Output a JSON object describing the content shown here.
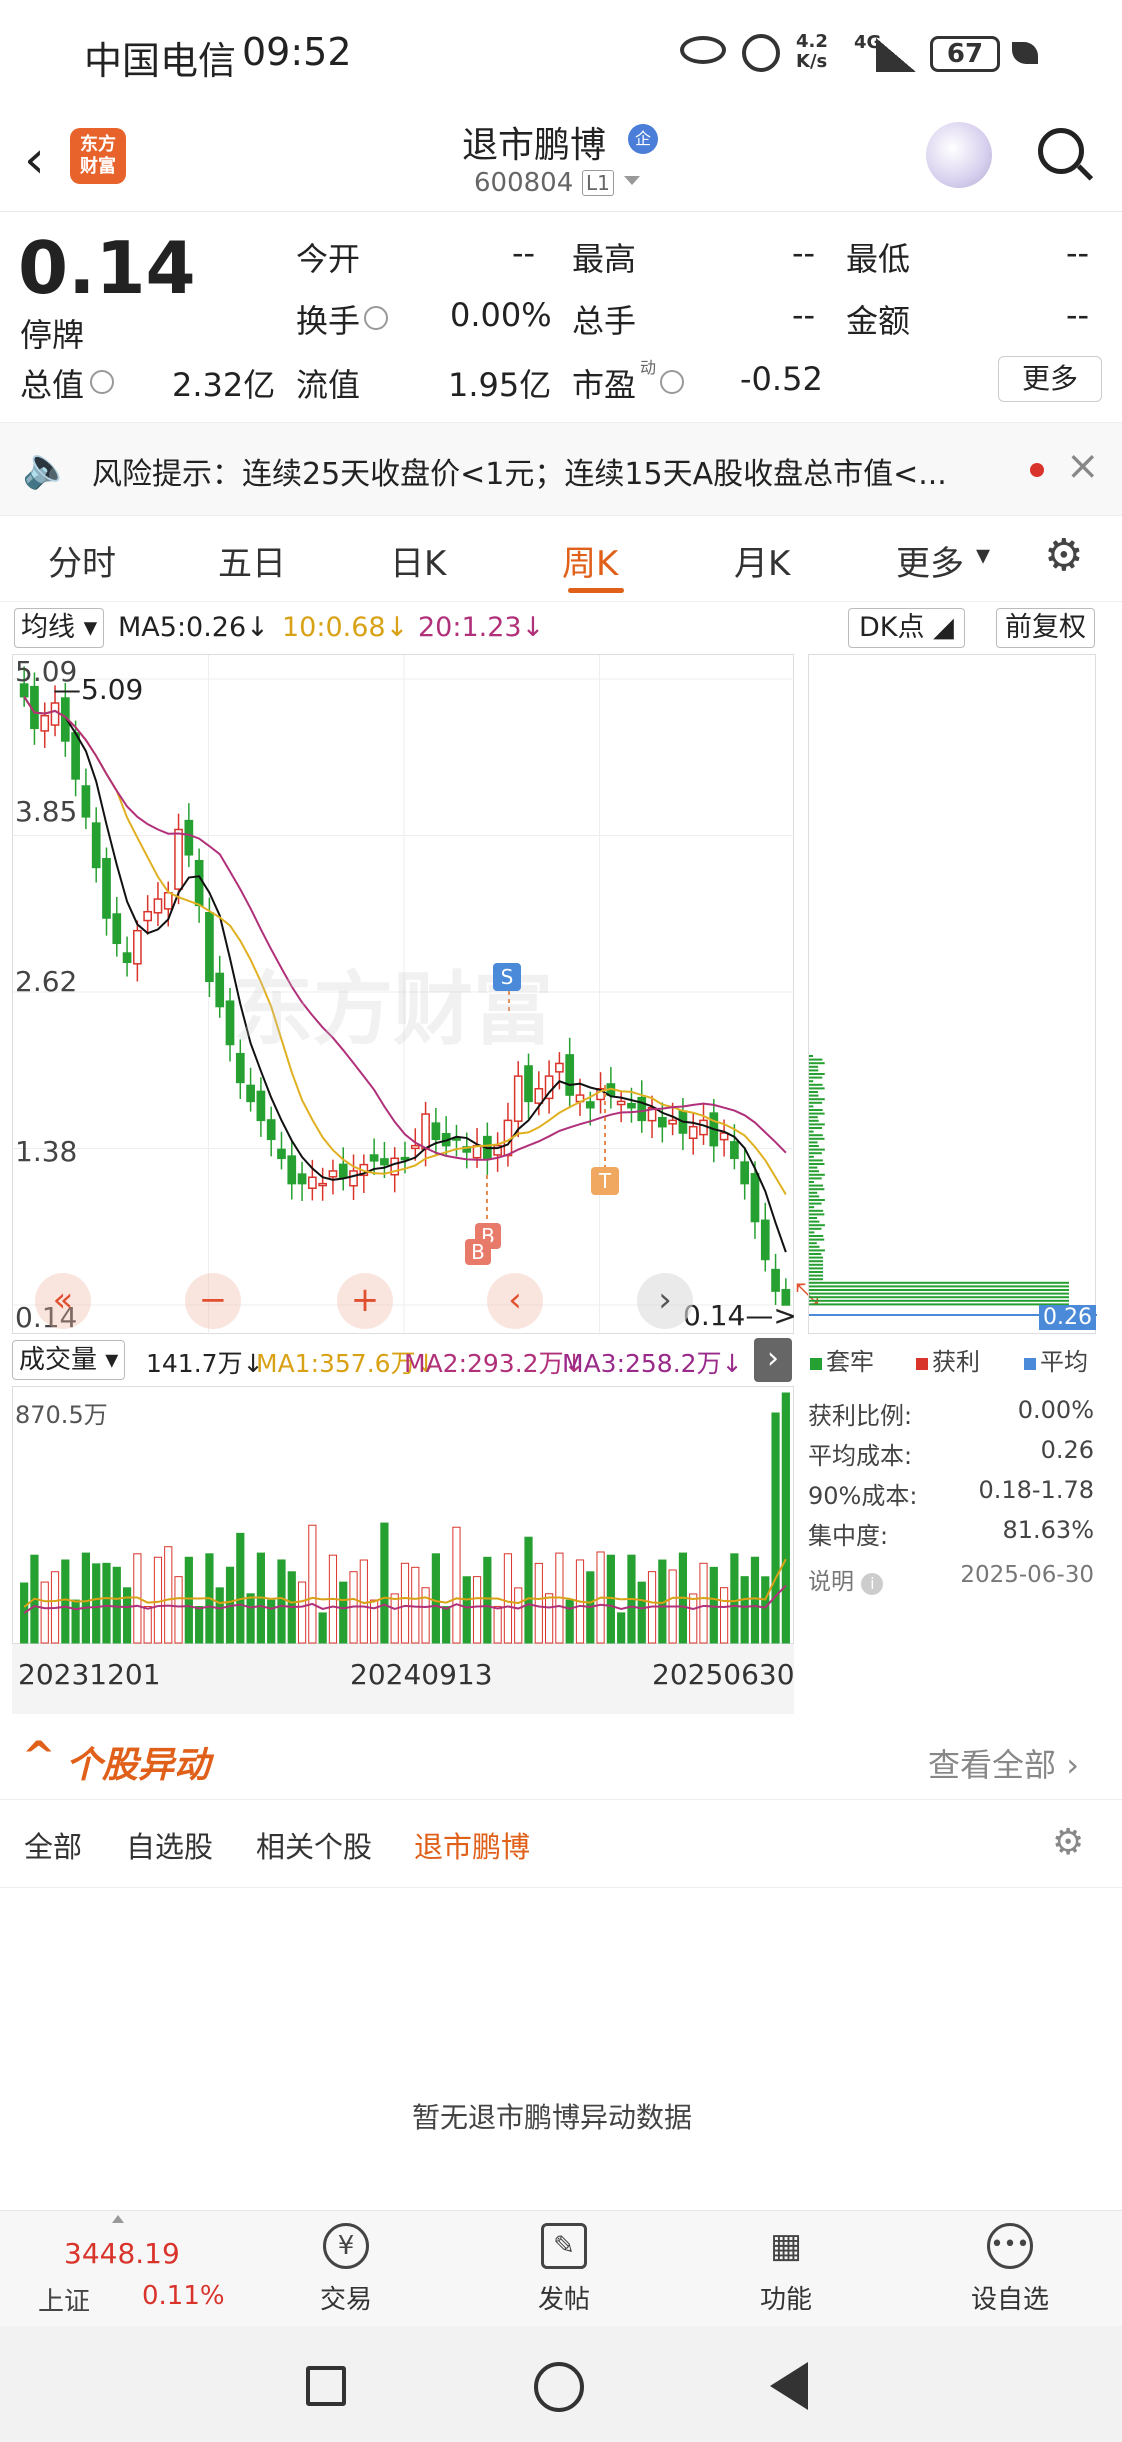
{
  "status_bar": {
    "carrier": "中国电信",
    "time": "09:52",
    "speed_top": "4.2",
    "speed_unit": "K/s",
    "signal": "4G",
    "battery": "67"
  },
  "header": {
    "logo_line1": "东方",
    "logo_line2": "财富",
    "title": "退市鹏博",
    "title_badge": "企",
    "code": "600804",
    "level": "L1"
  },
  "quote": {
    "price": "0.14",
    "status": "停牌",
    "open_label": "今开",
    "open": "--",
    "high_label": "最高",
    "high": "--",
    "low_label": "最低",
    "low": "--",
    "turnover_label": "换手",
    "turnover": "0.00%",
    "volume_label": "总手",
    "volume": "--",
    "amount_label": "金额",
    "amount": "--",
    "mktcap_label": "总值",
    "mktcap": "2.32亿",
    "float_label": "流值",
    "float": "1.95亿",
    "pe_label": "市盈",
    "pe_sup": "动",
    "pe": "-0.52",
    "more_button": "更多"
  },
  "risk": {
    "text": "风险提示：连续25天收盘价<1元；连续15天A股收盘总市值<..."
  },
  "tabs": {
    "items": [
      "分时",
      "五日",
      "日K",
      "周K",
      "月K",
      "更多"
    ],
    "active": "周K"
  },
  "chart_toolbar": {
    "mode": "均线",
    "ma5": "MA5:0.26",
    "ma10": "10:0.68",
    "ma20": "20:1.23",
    "dk_button": "DK点",
    "adjust_button": "前复权"
  },
  "chart_labels": {
    "max_label": "5.09",
    "min_label": "0.14",
    "marker_s": "S",
    "marker_b": "B",
    "marker_t": "T",
    "y_ticks": [
      "5.09",
      "3.85",
      "2.62",
      "1.38",
      "0.14"
    ],
    "watermark": "东方财富"
  },
  "chip_panel": {
    "avg_label": "0.26",
    "legend": [
      "套牢",
      "获利",
      "平均"
    ],
    "rows": [
      {
        "label": "获利比例:",
        "value": "0.00%"
      },
      {
        "label": "平均成本:",
        "value": "0.26"
      },
      {
        "label": "90%成本:",
        "value": "0.18-1.78"
      },
      {
        "label": "集中度:",
        "value": "81.63%"
      }
    ],
    "note_label": "说明",
    "date": "2025-06-30"
  },
  "volume_toolbar": {
    "label": "成交量",
    "value": "141.7万",
    "ma1": "MA1:357.6万",
    "ma2": "MA2:293.2万",
    "ma3": "MA3:258.2万",
    "max": "870.5万"
  },
  "x_axis": [
    "20231201",
    "20240913",
    "20250630"
  ],
  "movement": {
    "title": "个股异动",
    "view_all": "查看全部",
    "filters": [
      "全部",
      "自选股",
      "相关个股",
      "退市鹏博"
    ],
    "active_filter": "退市鹏博",
    "empty_text": "暂无退市鹏博异动数据"
  },
  "bottom_nav": {
    "index_value": "3448.19",
    "index_name": "上证",
    "index_change": "0.11%",
    "items": [
      "交易",
      "发帖",
      "功能",
      "设自选"
    ]
  },
  "chart_data": {
    "type": "candlestick",
    "title": "",
    "ylim": [
      0.14,
      5.09
    ],
    "closes": [
      4.95,
      4.7,
      4.8,
      4.9,
      4.6,
      4.3,
      4.0,
      3.6,
      3.2,
      3.0,
      2.85,
      3.1,
      3.25,
      3.35,
      3.4,
      3.9,
      3.7,
      3.3,
      2.7,
      2.5,
      2.2,
      1.9,
      1.75,
      1.6,
      1.45,
      1.3,
      1.1,
      1.1,
      1.15,
      1.1,
      1.2,
      1.15,
      1.2,
      1.25,
      1.28,
      1.25,
      1.3,
      1.3,
      1.4,
      1.65,
      1.45,
      1.4,
      1.45,
      1.35,
      1.4,
      1.3,
      1.4,
      1.6,
      1.95,
      1.75,
      1.85,
      1.95,
      2.05,
      1.8,
      1.8,
      1.7,
      1.85,
      1.8,
      1.75,
      1.7,
      1.6,
      1.7,
      1.55,
      1.6,
      1.5,
      1.55,
      1.6,
      1.4,
      1.5,
      1.3,
      1.1,
      0.8,
      0.5,
      0.25,
      0.14
    ],
    "ma_colors": {
      "ma5": "#111111",
      "ma10": "#e0b020",
      "ma20": "#b0307a"
    }
  }
}
